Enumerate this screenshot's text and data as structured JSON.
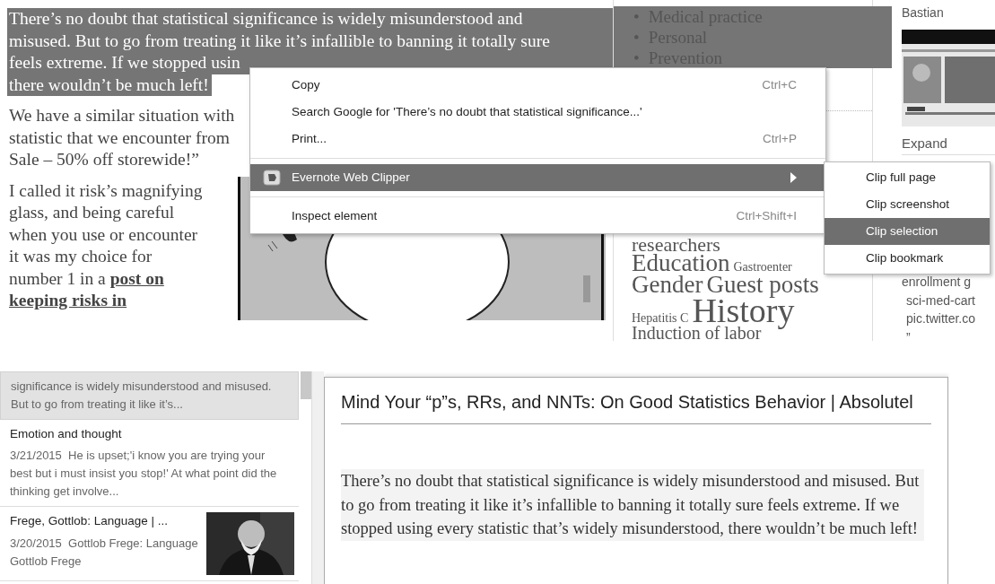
{
  "article": {
    "paragraphs": [
      {
        "selected": true,
        "lines": [
          {
            "text": "There’s no doubt that statistical significance is widely misunderstood and"
          },
          {
            "text": "misused. But to go from treating it like it’s infallible to banning it totally sure"
          },
          {
            "text": "feels extreme. If we stopped usin"
          },
          {
            "text": "there wouldn’t be much left!"
          }
        ]
      },
      {
        "selected": false,
        "lines": [
          {
            "text": "We have a similar situation with"
          },
          {
            "text": "statistic that we encounter from"
          },
          {
            "text": "Sale – 50% off storewide!”"
          }
        ]
      },
      {
        "selected": false,
        "lines": [
          {
            "text": "I called it risk’s magnifying"
          },
          {
            "text": "glass, and being careful"
          },
          {
            "text": "when you use or encounter"
          },
          {
            "text": "it was my choice for"
          },
          {
            "text": "number 1 in a",
            "link": "post on"
          },
          {
            "link": "keeping risks in"
          }
        ]
      }
    ],
    "illustration": {
      "kind": "picture"
    }
  },
  "sidebar": {
    "categories": [
      {
        "bullet": "•",
        "label": "Medical practice",
        "selected": true
      },
      {
        "bullet": "•",
        "label": "Personal",
        "selected": true
      },
      {
        "bullet": "•",
        "label": "Prevention",
        "selected": true
      }
    ],
    "tag_rows": [
      {
        "tags": [
          {
            "label": "researchers",
            "kind": "large"
          }
        ]
      },
      {
        "tags": [
          {
            "label": "Education",
            "kind": "xlarge"
          },
          {
            "label": "Gastroenter",
            "kind": "small"
          }
        ]
      },
      {
        "tags": [
          {
            "label": "Gender",
            "kind": "xlarge"
          },
          {
            "label": "Guest posts",
            "kind": "xlarge"
          }
        ]
      },
      {
        "tags": [
          {
            "label": "Hepatitis C",
            "kind": "small"
          },
          {
            "label": "History",
            "kind": "huge"
          }
        ]
      },
      {
        "tags": [
          {
            "label": "Induction of labor",
            "kind": "medium"
          }
        ]
      }
    ]
  },
  "right_column": {
    "name": "Bastian",
    "thumbnail": {
      "kind": "picture"
    },
    "expand": "Expand",
    "lines": [
      "enrollment g",
      "sci-med-cart",
      "pic.twitter.co",
      "”"
    ]
  },
  "context_menu": {
    "items": [
      {
        "kind": "item",
        "label": "Copy",
        "shortcut": "Ctrl+C",
        "selected": false
      },
      {
        "kind": "item",
        "label": "Search Google for 'There’s no doubt that statistical significance...'",
        "selected": false
      },
      {
        "kind": "item",
        "label": "Print...",
        "shortcut": "Ctrl+P",
        "selected": false
      },
      {
        "kind": "separator"
      },
      {
        "kind": "submenu",
        "label": "Evernote Web Clipper",
        "selected": true
      },
      {
        "kind": "separator"
      },
      {
        "kind": "item",
        "label": "Inspect element",
        "shortcut": "Ctrl+Shift+I",
        "selected": false
      }
    ],
    "submenu": [
      {
        "label": "Clip full page",
        "selected": false
      },
      {
        "label": "Clip screenshot",
        "selected": false
      },
      {
        "label": "Clip selection",
        "selected": true
      },
      {
        "label": "Clip bookmark",
        "selected": false
      }
    ]
  },
  "notes_list": [
    {
      "selected": true,
      "snippet": "significance is widely misunderstood and misused. But to go from treating it like it’s..."
    },
    {
      "selected": false,
      "title": "Emotion and thought",
      "date": "3/21/2015",
      "snippet": "He is upset;'i know you are trying your best but i must insist you stop!' At what point did the thinking get involve..."
    },
    {
      "selected": false,
      "title": "Frege, Gottlob: Language | ...",
      "date": "3/20/2015",
      "snippet": "Gottlob Frege: Language Gottlob Frege",
      "thumbnail": {
        "kind": "picture"
      }
    }
  ],
  "note": {
    "title": "Mind Your “p”s, RRs, and NNTs: On Good Statistics Behavior | Absolutel",
    "body": "There’s no doubt that statistical significance is widely misunderstood and misused. But to go from treating it like it’s infallible to banning it totally sure feels extreme. If we stopped using every statistic that’s widely misunderstood, there wouldn’t be much left!"
  }
}
